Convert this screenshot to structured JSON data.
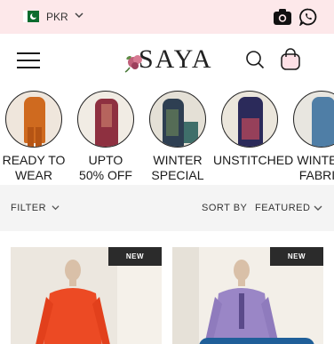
{
  "topbar": {
    "currency": "PKR",
    "icons": [
      "pakistan-flag-icon",
      "chevron-down-icon",
      "camera-icon",
      "whatsapp-icon"
    ]
  },
  "header": {
    "logo_text": "SAYA",
    "icons": [
      "hamburger-menu-icon",
      "search-icon",
      "shopping-bag-icon"
    ]
  },
  "categories": [
    {
      "label": "READY TO\nWEAR"
    },
    {
      "label": "UPTO\n50% OFF"
    },
    {
      "label": "WINTER\nSPECIAL"
    },
    {
      "label": "UNSTITCHED"
    },
    {
      "label": "WINTER\nFABRIC"
    }
  ],
  "filterbar": {
    "filter_label": "FILTER",
    "sort_by_label": "SORT BY",
    "sort_value": "FEATURED"
  },
  "products": [
    {
      "badge": "NEW"
    },
    {
      "badge": "NEW"
    }
  ],
  "colors": {
    "topbar_bg": "#fde8ea",
    "filter_bg": "#f4f4f4",
    "badge_bg": "#2b2b2b",
    "fab_blue": "#1f5f99"
  }
}
